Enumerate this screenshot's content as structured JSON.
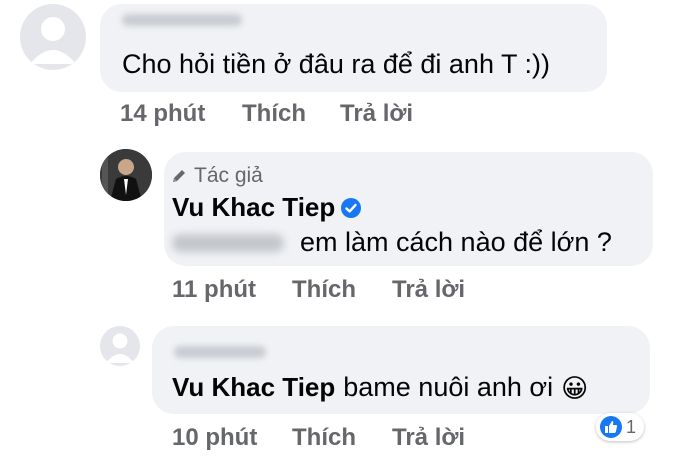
{
  "comments": [
    {
      "text": "Cho hỏi tiền ở đâu ra để đi anh T :))",
      "time": "14 phút",
      "like_label": "Thích",
      "reply_label": "Trả lời"
    },
    {
      "author_tag": "Tác giả",
      "author_name": "Vu Khac Tiep",
      "text": "em làm cách nào để lớn ?",
      "time": "11 phút",
      "like_label": "Thích",
      "reply_label": "Trả lời"
    },
    {
      "mention": "Vu Khac Tiep",
      "text": "bame nuôi anh ơi",
      "emoji": "😀",
      "time": "10 phút",
      "like_label": "Thích",
      "reply_label": "Trả lời",
      "reaction_count": "1"
    }
  ],
  "colors": {
    "bubble": "#f0f2f5",
    "meta": "#65676b",
    "accent": "#1877f2"
  }
}
